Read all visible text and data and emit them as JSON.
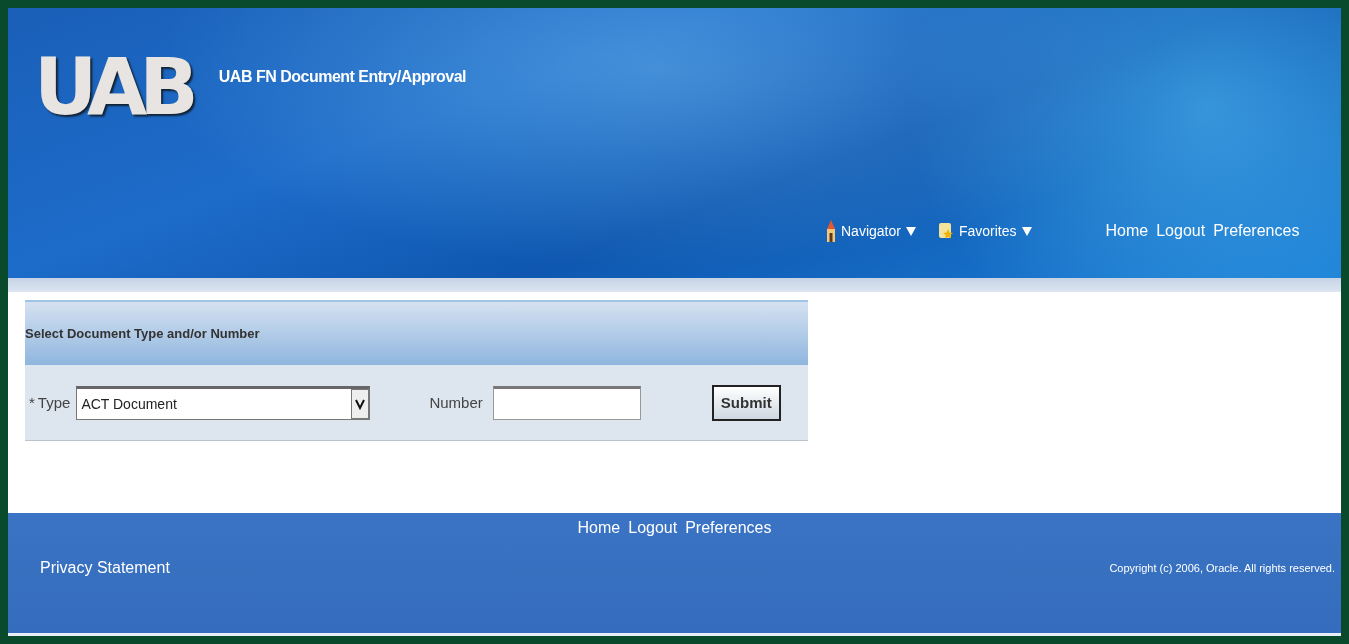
{
  "header": {
    "logo": "UAB",
    "title": "UAB FN Document Entry/Approval",
    "menus": [
      {
        "label": "Navigator",
        "kind": "home"
      },
      {
        "label": "Favorites",
        "kind": "star"
      }
    ],
    "links": [
      "Home",
      "Logout",
      "Preferences"
    ]
  },
  "form": {
    "heading": "Select Document Type and/or Number",
    "required_mark": "*",
    "type_label": "Type",
    "type_value": "ACT Document",
    "number_label": "Number",
    "submit": "Submit"
  },
  "footer": {
    "links": [
      "Home",
      "Logout",
      "Preferences"
    ],
    "privacy": "Privacy Statement",
    "copyright": "Copyright (c) 2006, Oracle. All rights reserved."
  }
}
